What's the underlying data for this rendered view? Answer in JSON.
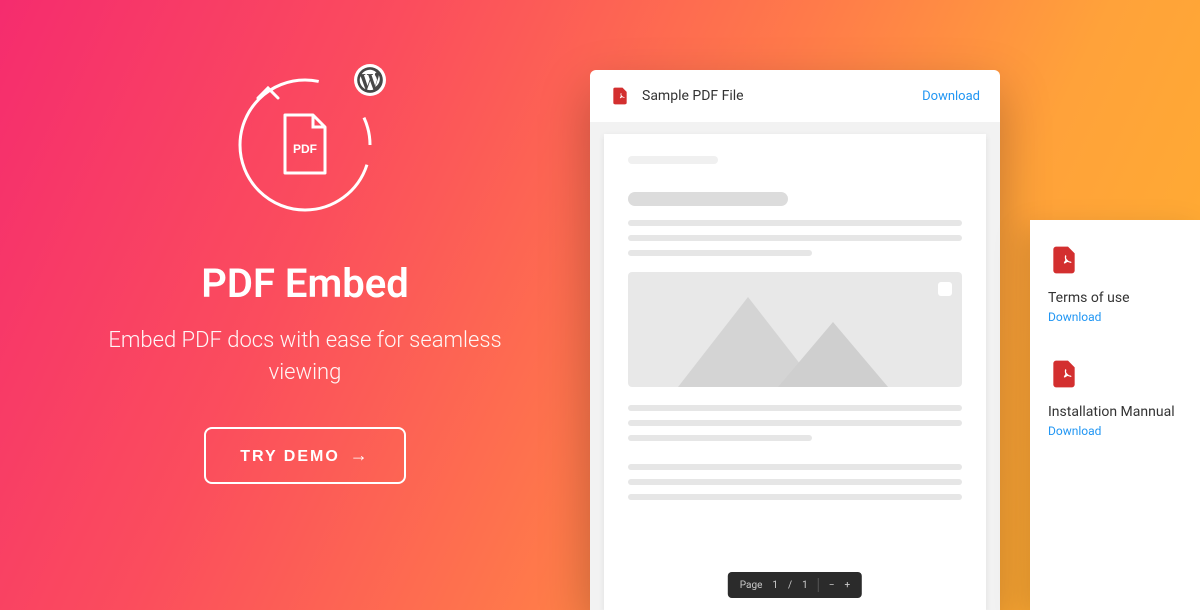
{
  "hero": {
    "title": "PDF Embed",
    "subtitle": "Embed PDF docs with ease for seamless viewing",
    "cta_label": "TRY DEMO"
  },
  "viewer": {
    "title": "Sample PDF File",
    "download_label": "Download",
    "toolbar": {
      "page_label": "Page",
      "current": "1",
      "total": "1"
    }
  },
  "sidebar": {
    "items": [
      {
        "title": "Terms of use",
        "link": "Download"
      },
      {
        "title": "Installation Mannual",
        "link": "Download"
      }
    ]
  }
}
